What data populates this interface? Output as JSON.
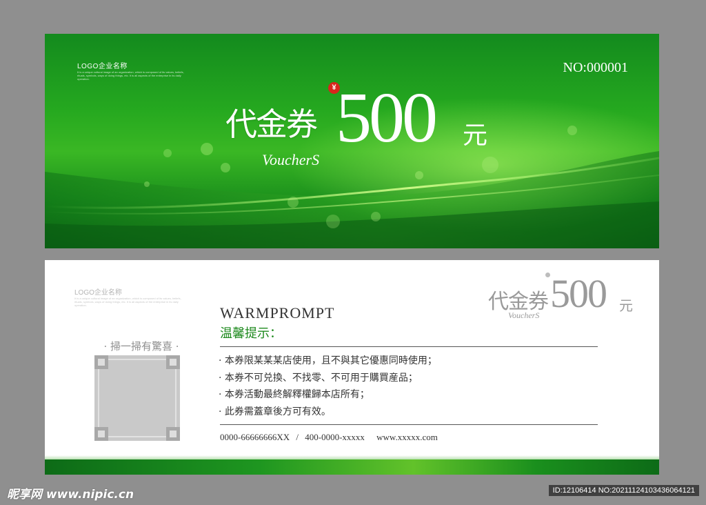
{
  "front": {
    "logo": "LOGO企业名称",
    "logo_fine": "It is a unique cultural image of an organization, which is composed of its values, beliefs, rituals, symbols, ways of doing things, etc. It is all aspects of the enterprise in its daily operation.",
    "serial": "NO:000001",
    "currency_symbol": "¥",
    "title_cn": "代金券",
    "amount": "500",
    "unit": "元",
    "title_en": "VoucherS"
  },
  "back": {
    "logo": "LOGO企业名称",
    "logo_fine": "It is a unique cultural image of an organization, which is composed of its values, beliefs, rituals, symbols, ways of doing things, etc. It is all aspects of the enterprise in its daily operation.",
    "mini_title_cn": "代金券",
    "mini_amount": "500",
    "mini_unit": "元",
    "mini_title_en": "VoucherS",
    "scratch_label": "· 掃一掃有驚喜 ·",
    "heading_en": "WARMPROMPT",
    "heading_cn": "温馨提示：",
    "rules": [
      "· 本券限某某某店使用，且不與其它優惠同時使用；",
      "· 本券不可兑換、不找零、不可用于購買産品；",
      "· 本券活動最終解釋權歸本店所有；",
      "· 此券需蓋章後方可有效。"
    ],
    "phone1": "0000-66666666XX",
    "separator": "/",
    "phone2": "400-0000-xxxxx",
    "website": "www.xxxxx.com"
  },
  "watermark": {
    "site": "昵享网 www.nipic.cn",
    "id_text": "ID:12106414 NO:20211124103436064121"
  },
  "colors": {
    "background": "#8f8f8f",
    "front_green": "#25a81f",
    "accent_green": "#1e8a1e",
    "yen_red": "#d8261c"
  }
}
